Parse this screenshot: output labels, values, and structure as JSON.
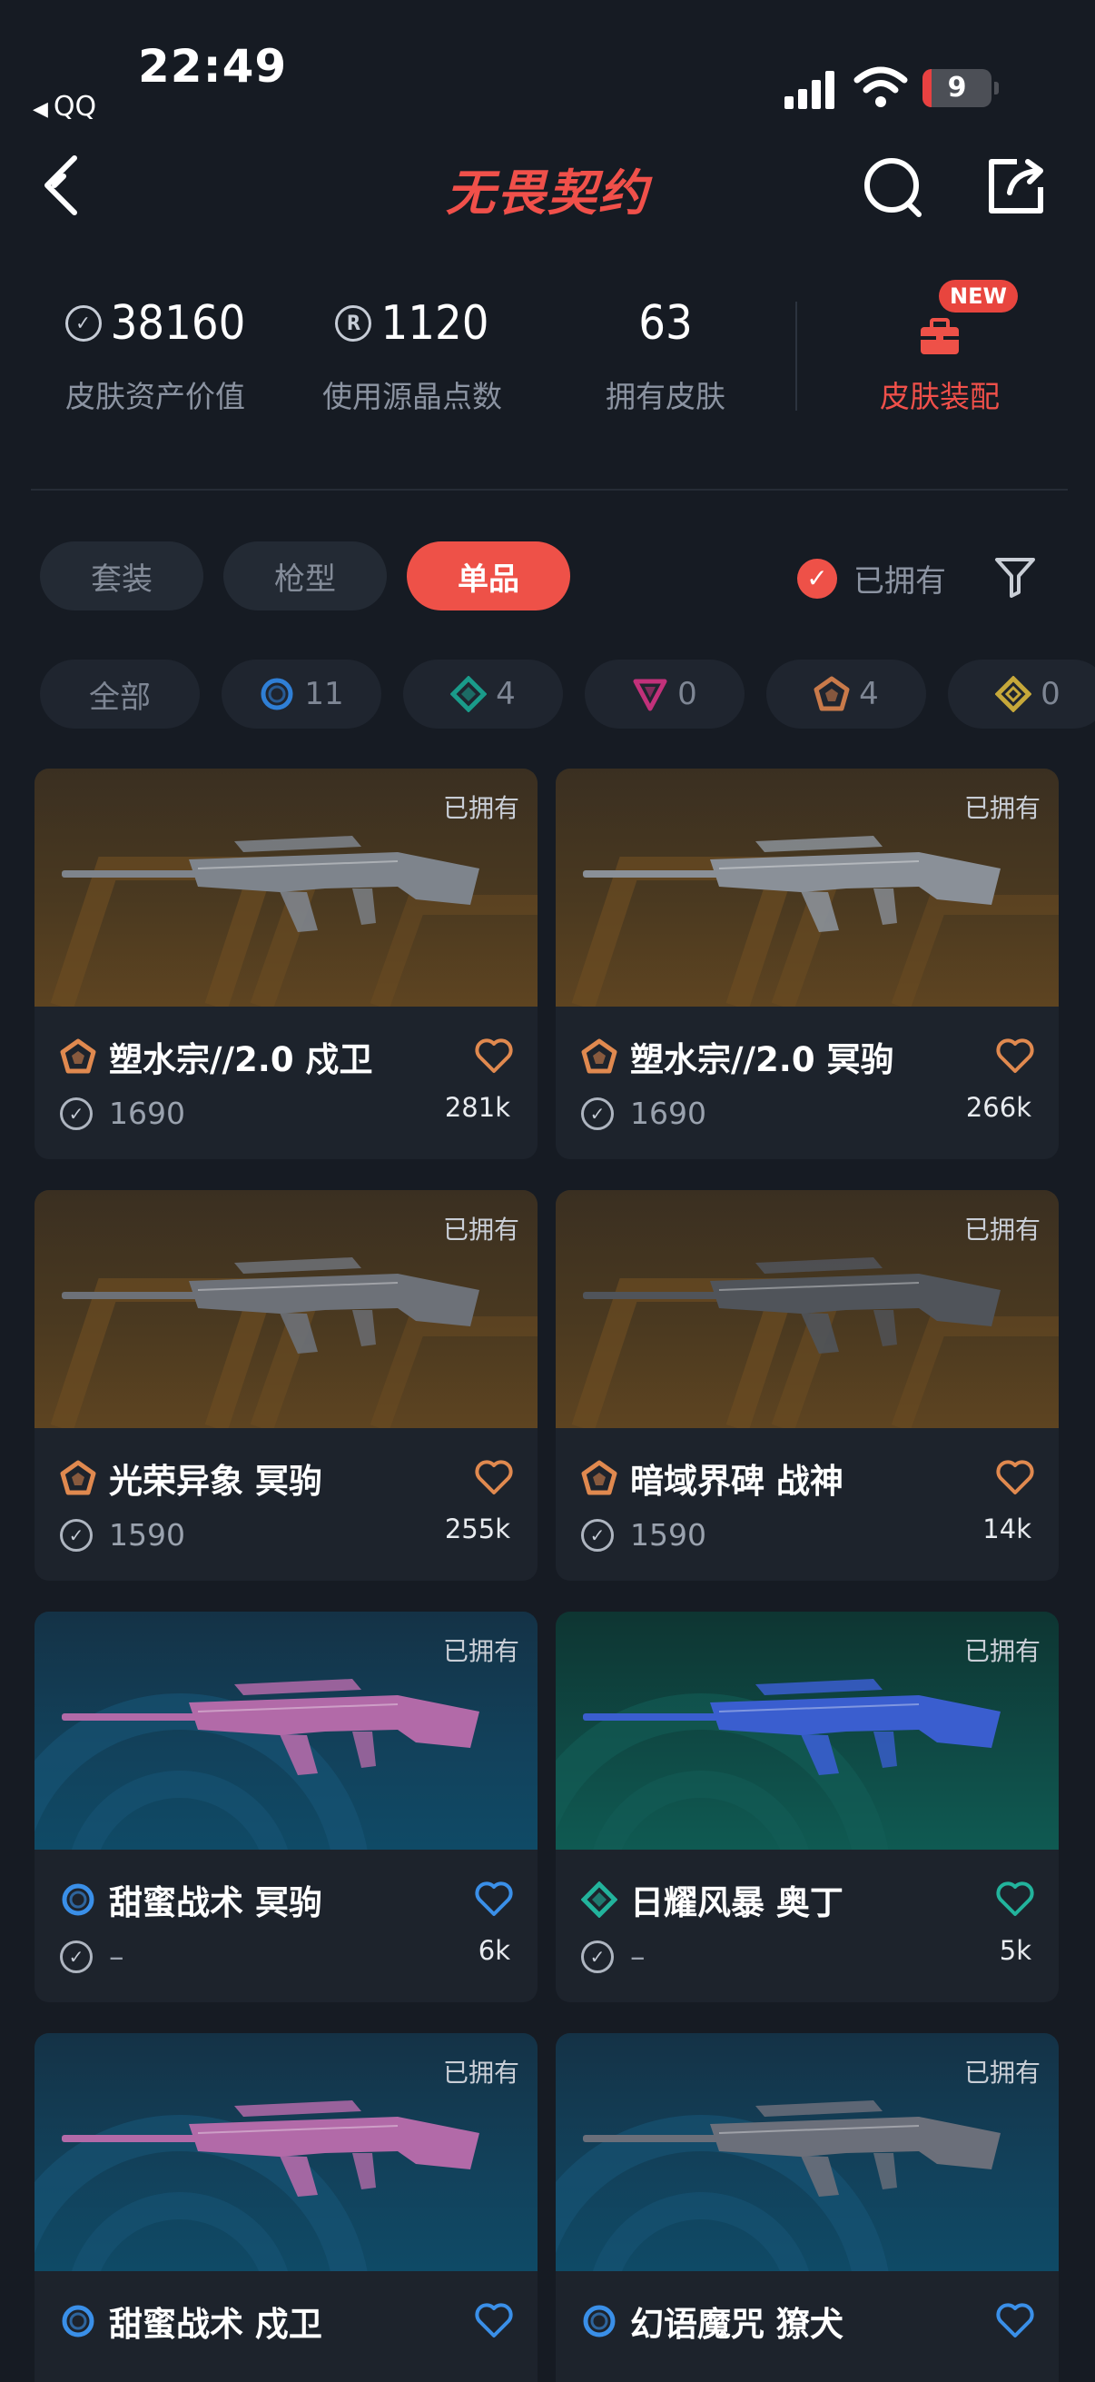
{
  "status_bar": {
    "time": "22:49",
    "back_app": "QQ",
    "battery": "9"
  },
  "nav": {
    "title": "无畏契约"
  },
  "stats": [
    {
      "value": "38160",
      "label": "皮肤资产价值",
      "icon": "vp-coin-icon"
    },
    {
      "value": "1120",
      "label": "使用源晶点数",
      "icon": "radianite-coin-icon"
    },
    {
      "value": "63",
      "label": "拥有皮肤"
    }
  ],
  "equip": {
    "label": "皮肤装配",
    "badge": "NEW"
  },
  "tabs": [
    {
      "label": "套装",
      "active": false
    },
    {
      "label": "枪型",
      "active": false
    },
    {
      "label": "单品",
      "active": true
    }
  ],
  "owned_filter": {
    "label": "已拥有",
    "checked": true
  },
  "chips": [
    {
      "label": "全部"
    },
    {
      "count": "11",
      "tier": "select",
      "color": "#2f7fd6"
    },
    {
      "count": "4",
      "tier": "deluxe",
      "color": "#1a9b8a"
    },
    {
      "count": "0",
      "tier": "premium",
      "color": "#c2317a"
    },
    {
      "count": "4",
      "tier": "exclusive",
      "color": "#c97a4a"
    },
    {
      "count": "0",
      "tier": "ultra",
      "color": "#c6a83a"
    }
  ],
  "cards": [
    {
      "name": "塑水宗//2.0 戍卫",
      "price": "1690",
      "likes": "281k",
      "owned": "已拥有",
      "tier": "exclusive",
      "bg": "orange"
    },
    {
      "name": "塑水宗//2.0 冥驹",
      "price": "1690",
      "likes": "266k",
      "owned": "已拥有",
      "tier": "exclusive",
      "bg": "orange"
    },
    {
      "name": "光荣异象 冥驹",
      "price": "1590",
      "likes": "255k",
      "owned": "已拥有",
      "tier": "exclusive",
      "bg": "orange"
    },
    {
      "name": "暗域界碑 战神",
      "price": "1590",
      "likes": "14k",
      "owned": "已拥有",
      "tier": "exclusive",
      "bg": "orange"
    },
    {
      "name": "甜蜜战术 冥驹",
      "price": "–",
      "likes": "6k",
      "owned": "已拥有",
      "tier": "select",
      "bg": "teal"
    },
    {
      "name": "日耀风暴 奥丁",
      "price": "–",
      "likes": "5k",
      "owned": "已拥有",
      "tier": "deluxe",
      "bg": "green"
    },
    {
      "name": "甜蜜战术 戍卫",
      "price": "",
      "likes": "",
      "owned": "已拥有",
      "tier": "select",
      "bg": "teal"
    },
    {
      "name": "幻语魔咒 獠犬",
      "price": "",
      "likes": "",
      "owned": "已拥有",
      "tier": "select",
      "bg": "teal"
    }
  ],
  "tier_colors": {
    "exclusive": "#e0894f",
    "select": "#3a8fe8",
    "deluxe": "#22b39c",
    "premium": "#d33c86",
    "ultra": "#d3b243"
  }
}
